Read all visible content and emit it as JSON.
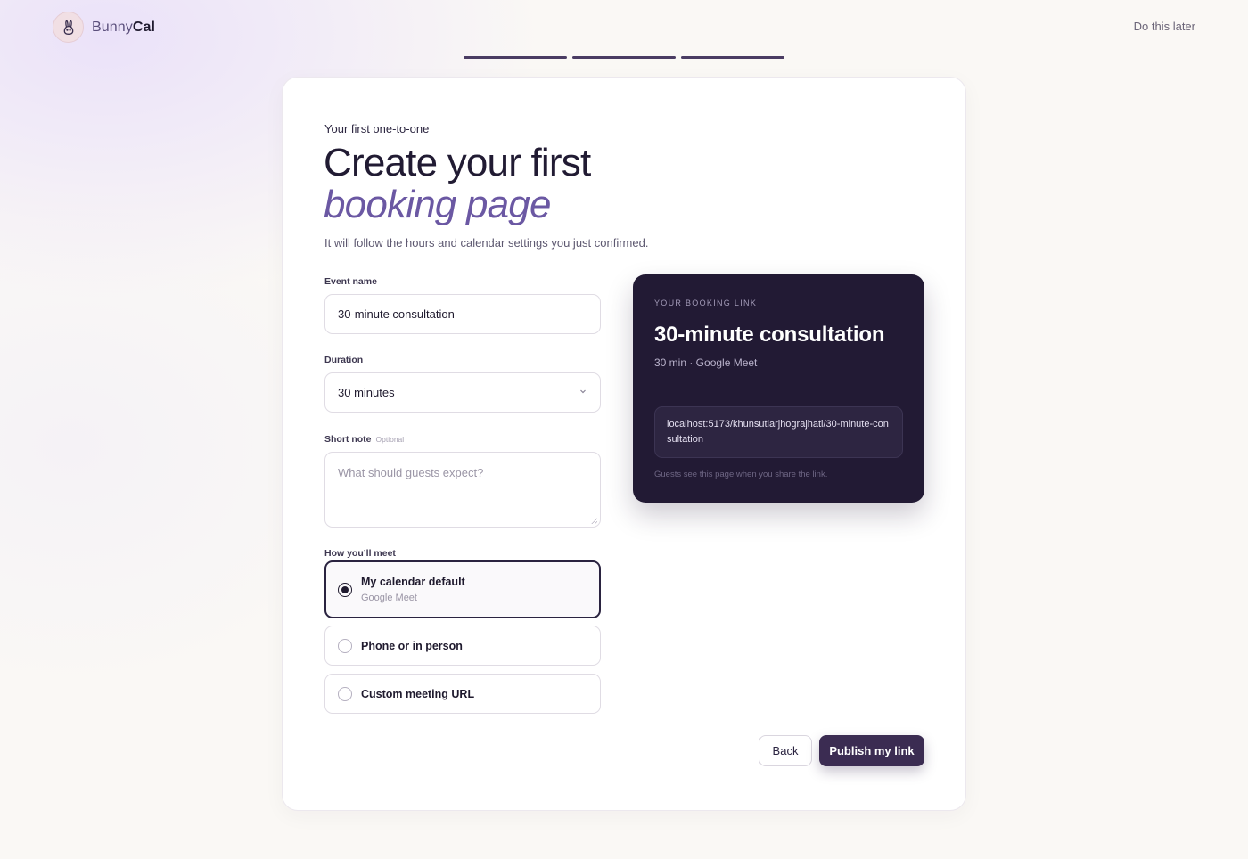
{
  "brand": {
    "name_prefix": "Bunny",
    "name_suffix": "Cal",
    "icon": "bunny-icon"
  },
  "header": {
    "skip_label": "Do this later"
  },
  "progress": {
    "steps_total": 3,
    "steps_completed": 3
  },
  "form": {
    "eyebrow": "Your first one-to-one",
    "title_line1": "Create your first",
    "title_line2": "booking page",
    "subtitle": "It will follow the hours and calendar settings you just confirmed.",
    "event_name": {
      "label": "Event name",
      "value": "30-minute consultation"
    },
    "duration": {
      "label": "Duration",
      "value": "30 minutes"
    },
    "note": {
      "label": "Short note",
      "optional": "Optional",
      "placeholder": "What should guests expect?"
    },
    "meeting": {
      "label": "How you’ll meet",
      "options": [
        {
          "title": "My calendar default",
          "subtitle": "Google Meet",
          "selected": true
        },
        {
          "title": "Phone or in person",
          "selected": false
        },
        {
          "title": "Custom meeting URL",
          "selected": false
        }
      ]
    }
  },
  "preview": {
    "eyebrow": "YOUR BOOKING LINK",
    "title": "30-minute consultation",
    "meta": "30 min · Google Meet",
    "url": "localhost:5173/khunsutiarjhograjhati/30-minute-consultation",
    "footnote": "Guests see this page when you share the link."
  },
  "actions": {
    "back_label": "Back",
    "publish_label": "Publish my link"
  },
  "colors": {
    "accent": "#6b58a3",
    "primary": "#3b2c52",
    "preview_bg": "#221a34",
    "page_bg": "#faf8f5"
  }
}
